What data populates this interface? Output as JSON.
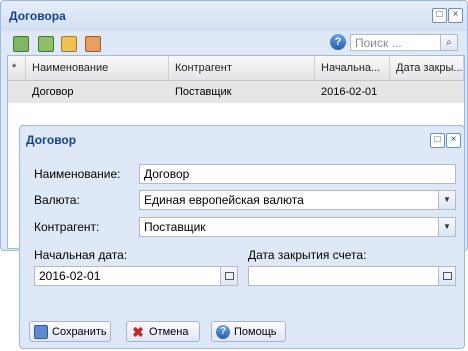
{
  "window": {
    "title": "Договора",
    "toolbar_icons": [
      "add-record-icon",
      "edit-record-icon",
      "copy-record-icon",
      "delete-record-icon"
    ],
    "help_glyph": "?",
    "search_placeholder": "Поиск ...",
    "grid": {
      "columns": [
        "*",
        "Наименование",
        "Контрагент",
        "Начальна...",
        "Дата закры..."
      ],
      "rows": [
        [
          "",
          "Договор",
          "Поставщик",
          "2016-02-01",
          ""
        ]
      ]
    }
  },
  "dialog": {
    "title": "Договор",
    "name_label": "Наименование:",
    "name_value": "Договор",
    "currency_label": "Валюта:",
    "currency_value": "Единая европейская валюта",
    "party_label": "Контрагент:",
    "party_value": "Поставщик",
    "start_label": "Начальная дата:",
    "start_value": "2016-02-01",
    "close_label": "Дата закрытия счета:",
    "close_value": "",
    "buttons": {
      "save": "Сохранить",
      "cancel": "Отмена",
      "help": "Помощь"
    }
  },
  "colors": {
    "accent": "#15428b",
    "panel": "#dfe8f6",
    "border": "#99bbe8"
  }
}
